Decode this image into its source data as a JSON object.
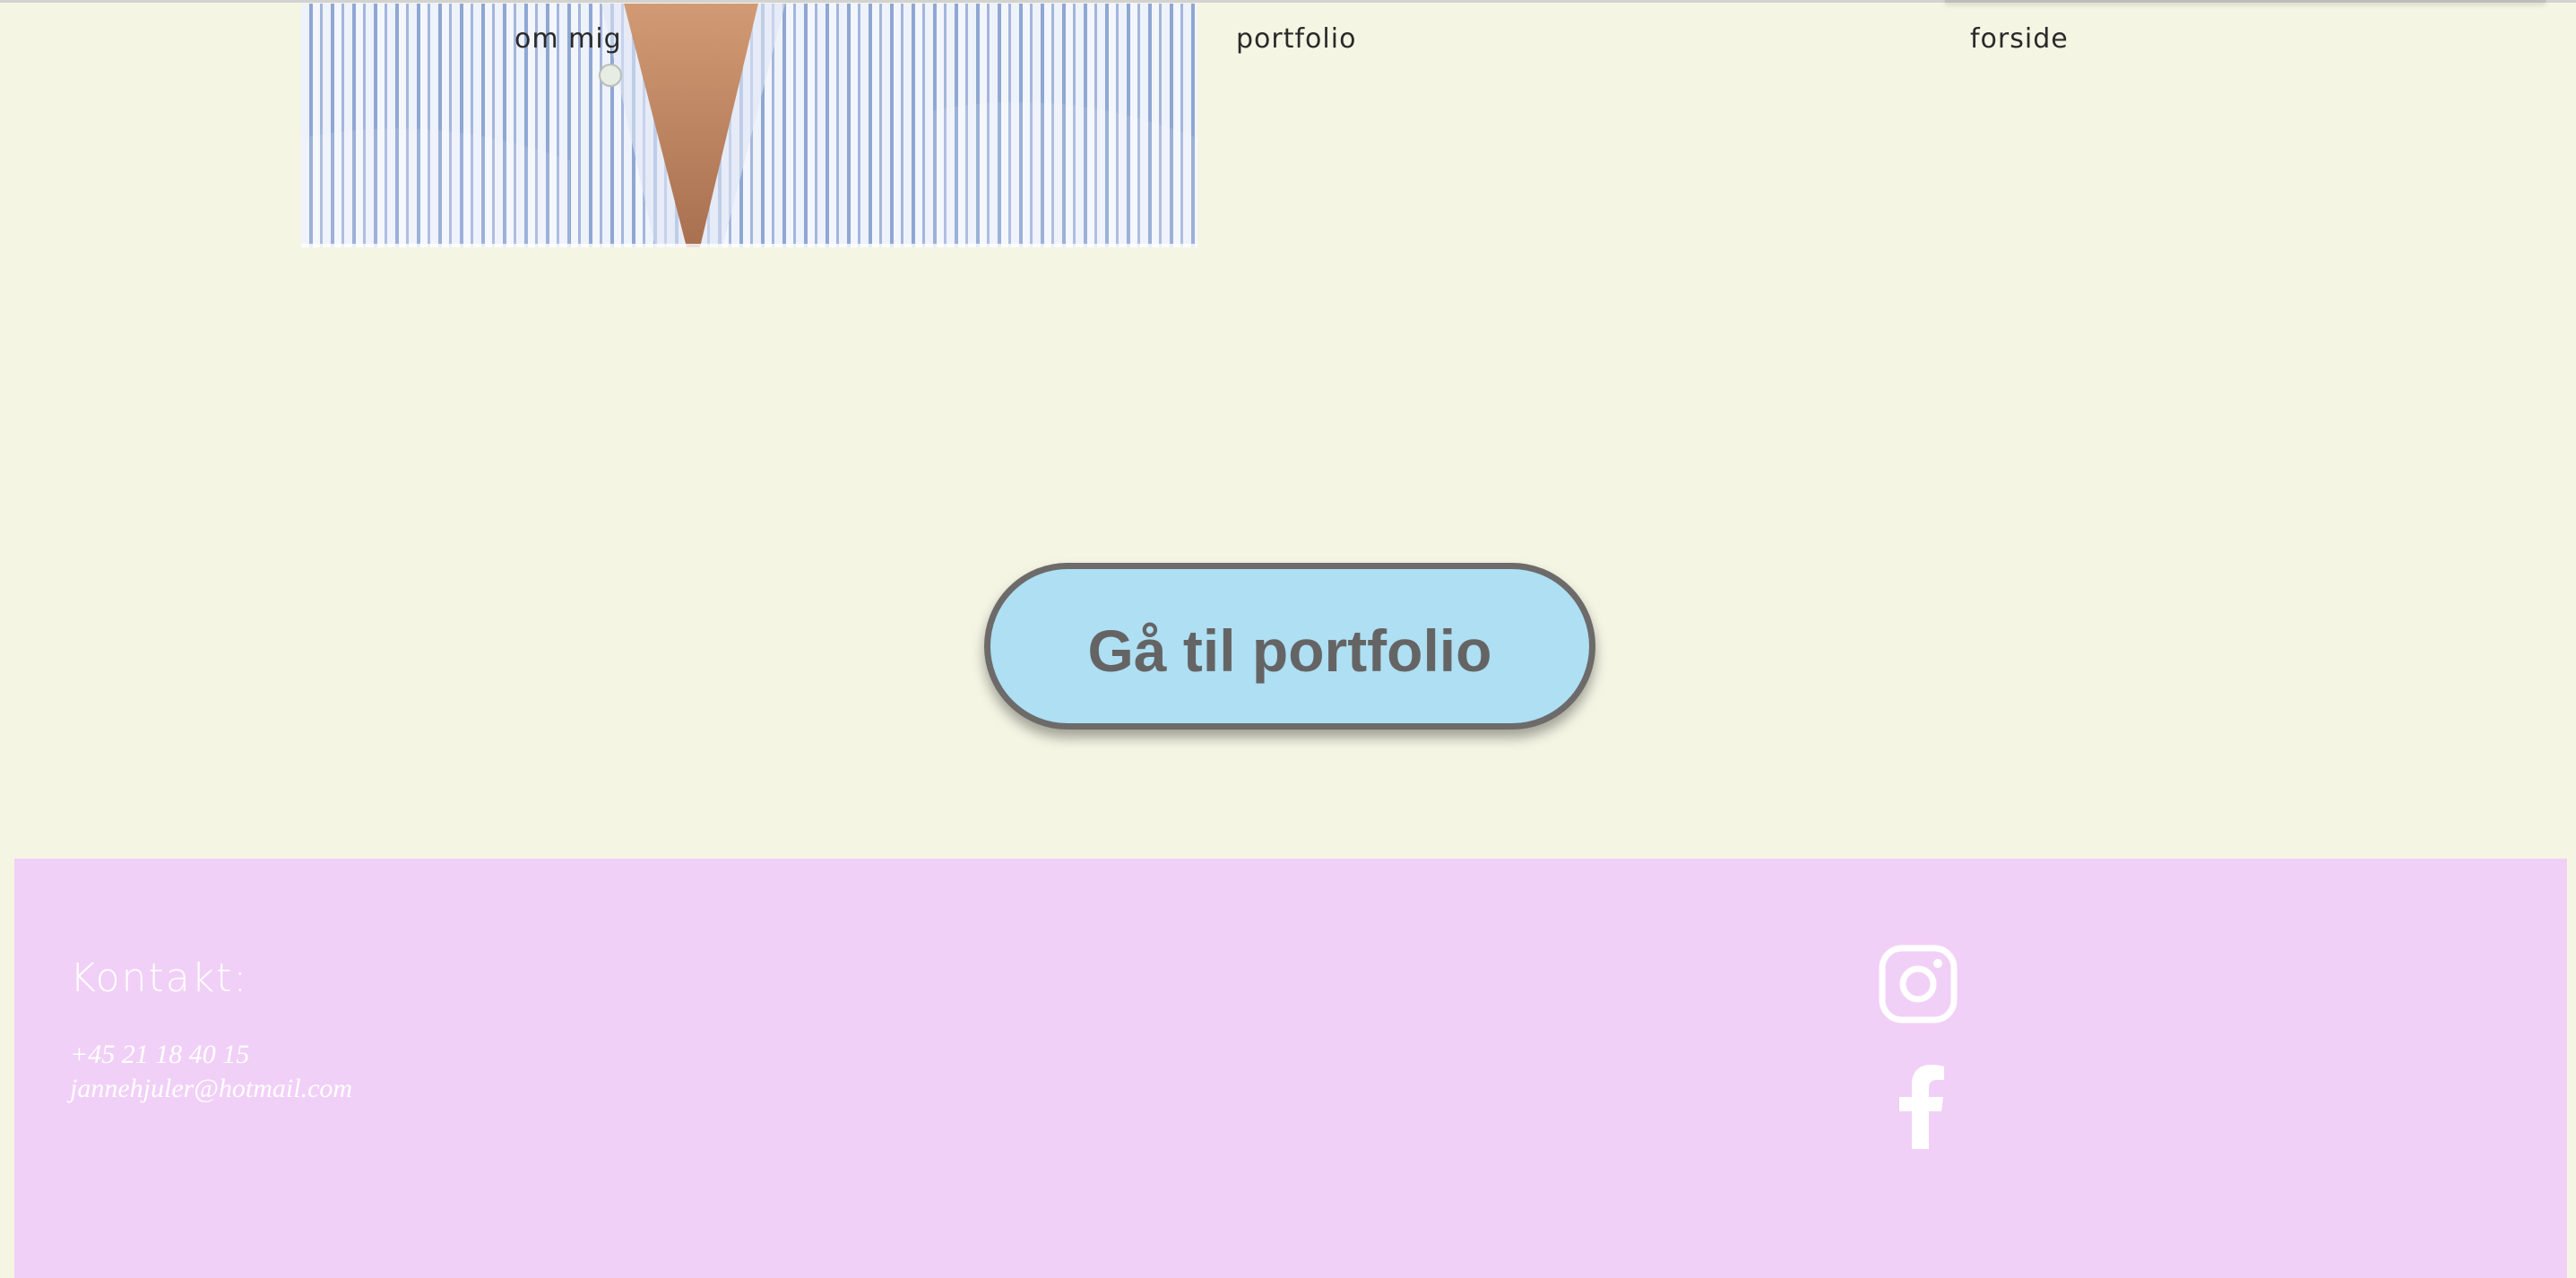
{
  "nav": {
    "items": [
      {
        "label": "om mig"
      },
      {
        "label": "portfolio"
      },
      {
        "label": "forside"
      }
    ]
  },
  "cta": {
    "label": "Gå til portfolio"
  },
  "footer": {
    "heading": "Kontakt:",
    "phone": "+45 21 18 40 15",
    "email": "jannehjuler@hotmail.com",
    "social": [
      {
        "icon": "instagram-icon"
      },
      {
        "icon": "facebook-icon"
      }
    ]
  },
  "colors": {
    "page_background": "#f5f5e4",
    "button_fill": "#aedff3",
    "button_border": "#6d6a6a",
    "button_text": "#656464",
    "footer_background": "#f1d0f7",
    "footer_text": "#ffffff"
  }
}
